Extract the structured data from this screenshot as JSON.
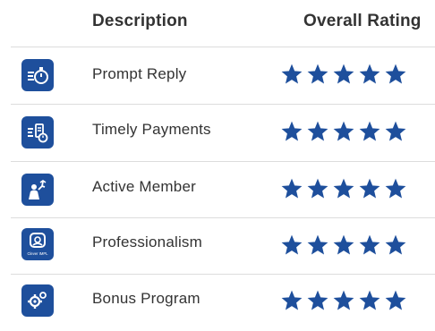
{
  "header": {
    "description": "Description",
    "overall_rating": "Overall Rating"
  },
  "rows": [
    {
      "label": "Prompt Reply",
      "icon": "stopwatch-icon",
      "rating": 5
    },
    {
      "label": "Timely Payments",
      "icon": "payment-clock-icon",
      "rating": 5
    },
    {
      "label": "Active Member",
      "icon": "active-person-icon",
      "rating": 5
    },
    {
      "label": "Professionalism",
      "icon": "professional-badge-icon",
      "icon_text": "Clever IMPL",
      "rating": 5
    },
    {
      "label": "Bonus Program",
      "icon": "gears-icon",
      "rating": 5
    }
  ],
  "colors": {
    "accent": "#1e4f9c",
    "text": "#333333",
    "divider": "#dcdcdc"
  }
}
